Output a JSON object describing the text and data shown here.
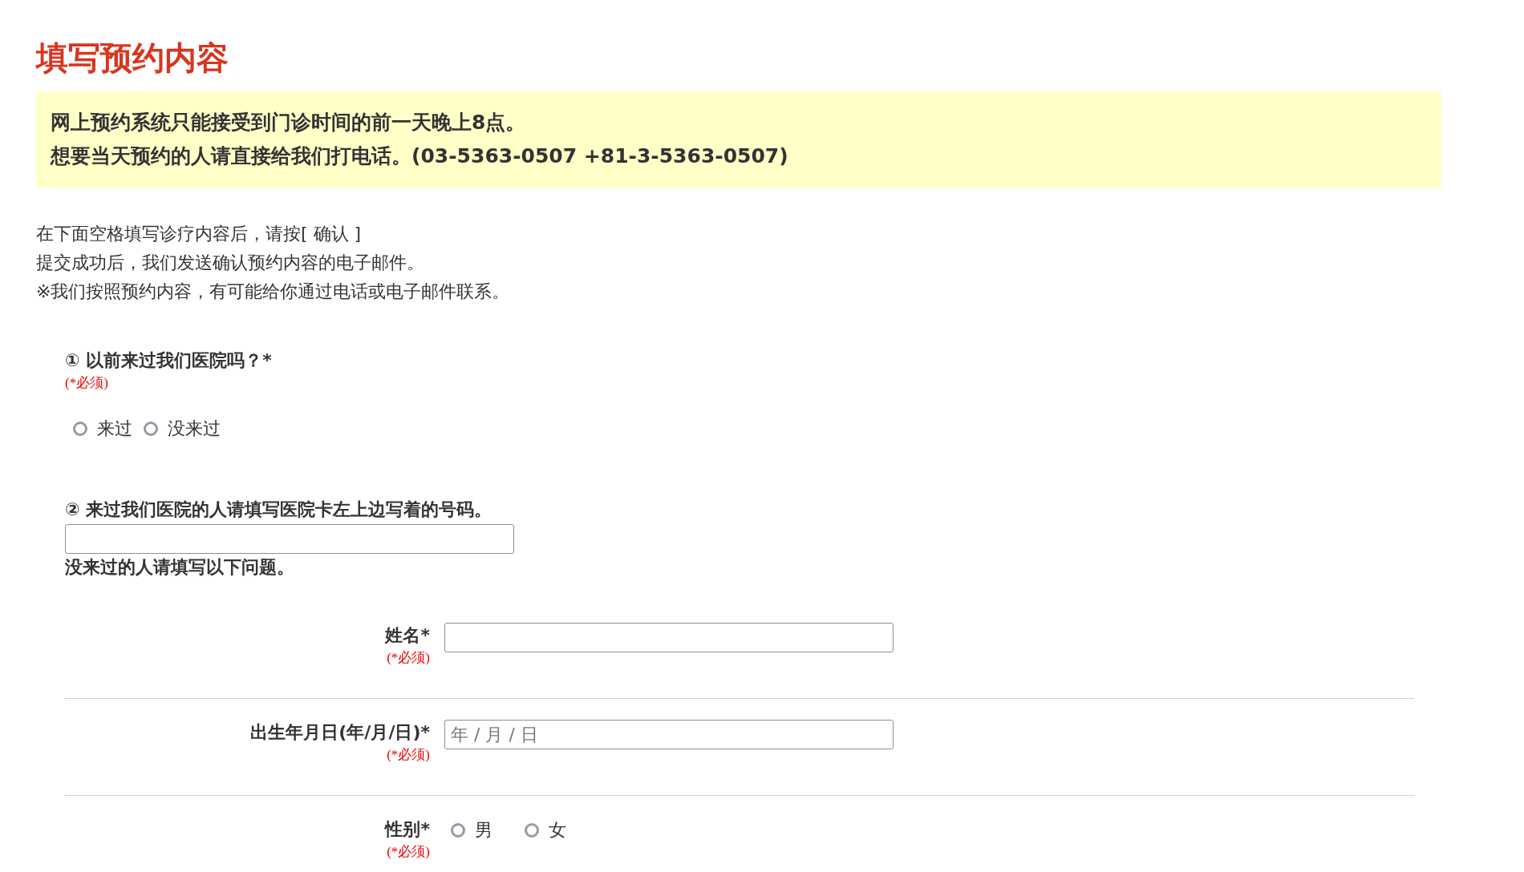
{
  "title": "填写预约内容",
  "notice": [
    "网上预约系统只能接受到门诊时间的前一天晚上8点。",
    "想要当天预约的人请直接给我们打电话。(03-5363-0507 +81-3-5363-0507)"
  ],
  "intro": [
    "在下面空格填写诊疗内容后，请按[ 确认 ]",
    "提交成功后，我们发送确认预约内容的电子邮件。",
    "※我们按照预约内容，有可能给你通过电话或电子邮件联系。"
  ],
  "question_1": {
    "label": "① 以前来过我们医院吗？*",
    "required": "(*必须)",
    "options": [
      {
        "label": "来过",
        "selected": false
      },
      {
        "label": "没来过",
        "selected": false
      }
    ]
  },
  "question_2": {
    "label": "② 来过我们医院的人请填写医院卡左上边写着的号码。",
    "note": "没来过的人请填写以下问题。"
  },
  "fields": [
    {
      "kind": "text",
      "label": "姓名*",
      "required": "(*必须)"
    },
    {
      "kind": "date",
      "label": "出生年月日(年/月/日)*",
      "required": "(*必须)",
      "placeholder": "年 / 月 / 日"
    },
    {
      "kind": "radio",
      "label": "性别*",
      "required": "(*必须)",
      "options": [
        {
          "label": "男",
          "selected": false
        },
        {
          "label": "女",
          "selected": false
        }
      ]
    }
  ]
}
